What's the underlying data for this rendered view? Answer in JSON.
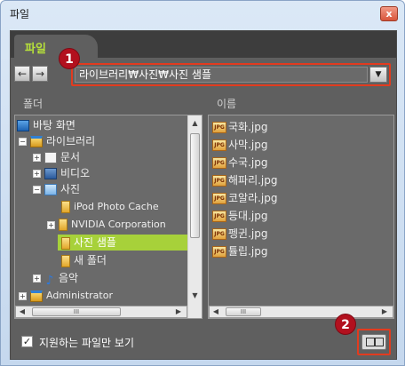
{
  "window": {
    "title": "파일",
    "close_glyph": "x"
  },
  "tab": {
    "label": "파일"
  },
  "nav": {
    "back_glyph": "←",
    "forward_glyph": "→",
    "path": "라이브러리₩사진₩사진 샘플",
    "dropdown_glyph": "▼"
  },
  "badges": {
    "one": "1",
    "two": "2"
  },
  "columns": {
    "folder_header": "폴더",
    "name_header": "이름"
  },
  "tree": [
    {
      "label": "바탕 화면",
      "icon": "desktop-icon",
      "expander": ""
    },
    {
      "label": "라이브러리",
      "icon": "library-icon",
      "expander": "−"
    },
    {
      "label": "문서",
      "icon": "documents-icon",
      "expander": "+"
    },
    {
      "label": "비디오",
      "icon": "video-icon",
      "expander": "+"
    },
    {
      "label": "사진",
      "icon": "pictures-icon",
      "expander": "−"
    },
    {
      "label": "iPod Photo Cache",
      "icon": "folder-icon",
      "expander": ""
    },
    {
      "label": "NVIDIA Corporation",
      "icon": "folder-icon",
      "expander": "+"
    },
    {
      "label": "사진 샘플",
      "icon": "folder-icon",
      "expander": "",
      "selected": true
    },
    {
      "label": "새 폴더",
      "icon": "folder-icon",
      "expander": ""
    },
    {
      "label": "음악",
      "icon": "music-icon",
      "expander": "+"
    },
    {
      "label": "Administrator",
      "icon": "library-icon",
      "expander": "+"
    }
  ],
  "files": [
    {
      "name": "국화.jpg",
      "icon": "jpg-icon"
    },
    {
      "name": "사막.jpg",
      "icon": "jpg-icon"
    },
    {
      "name": "수국.jpg",
      "icon": "jpg-icon"
    },
    {
      "name": "해파리.jpg",
      "icon": "jpg-icon"
    },
    {
      "name": "코알라.jpg",
      "icon": "jpg-icon"
    },
    {
      "name": "등대.jpg",
      "icon": "jpg-icon"
    },
    {
      "name": "펭귄.jpg",
      "icon": "jpg-icon"
    },
    {
      "name": "튤립.jpg",
      "icon": "jpg-icon"
    }
  ],
  "scroll_glyphs": {
    "up": "▲",
    "down": "▼",
    "left": "◀",
    "right": "▶",
    "grip": "III"
  },
  "jpg_badge_text": "JPG",
  "bottom": {
    "checkbox_label": "지원하는 파일만 보기",
    "checkbox_checked": true,
    "check_glyph": "✓"
  },
  "colors": {
    "accent_green": "#a7d13a",
    "highlight_red": "#e23b1f",
    "badge_red": "#b2101e"
  }
}
